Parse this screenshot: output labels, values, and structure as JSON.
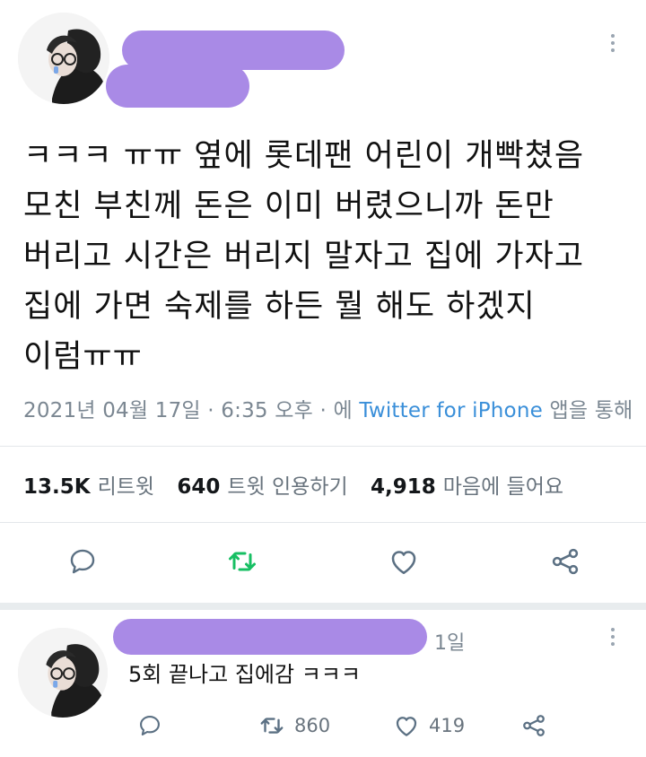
{
  "tweet": {
    "text": "ㅋㅋㅋ ㅠㅠ 옆에 롯데팬 어린이 개빡쳤음\n모친 부친께 돈은 이미 버렸으니까 돈만\n버리고 시간은 버리지 말자고 집에 가자고\n집에 가면 숙제를 하든 뭘 해도 하겠지\n이럼ㅠㅠ",
    "timestamp": "2021년 04월 17일 · 6:35 오후",
    "via_prefix": " · 에 ",
    "source": "Twitter for iPhone",
    "via_suffix": " 앱을 통해",
    "retweets": "13.5K",
    "retweets_label": "리트윗",
    "quotes": "640",
    "quotes_label": "트윗 인용하기",
    "likes": "4,918",
    "likes_label": "마음에 들어요"
  },
  "reply": {
    "time": "1일",
    "text": "5회 끝나고 집에감 ㅋㅋㅋ",
    "retweet_count": "860",
    "like_count": "419"
  },
  "icons": {
    "more": "more-vertical-icon",
    "reply": "comment-icon",
    "retweet": "retweet-icon",
    "like": "heart-icon",
    "share": "share-icon"
  },
  "colors": {
    "redaction": "#a98ae6",
    "link": "#3a8fd9",
    "retweet_active": "#17bf63",
    "muted": "#68737d"
  }
}
